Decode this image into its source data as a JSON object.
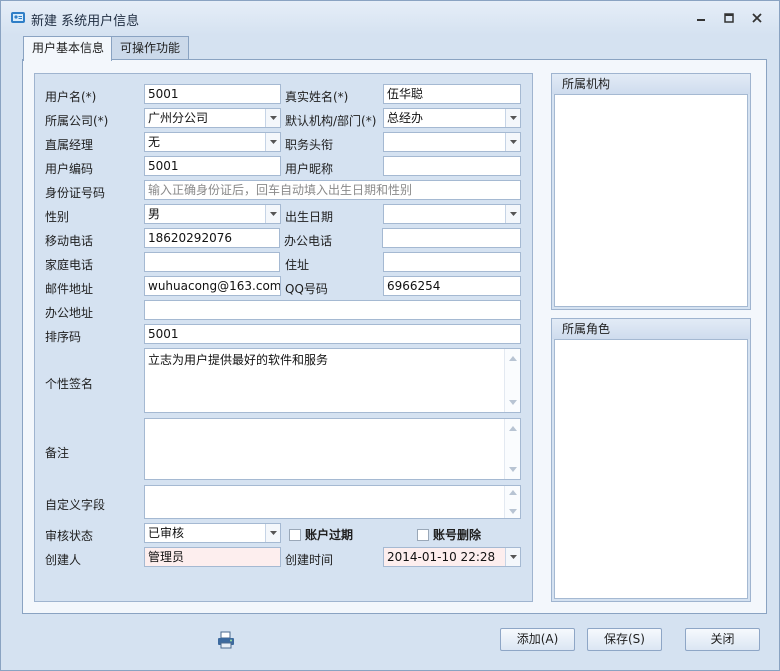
{
  "window": {
    "title": "新建 系统用户信息",
    "icon": "user-info-icon"
  },
  "tabs": [
    {
      "label": "用户基本信息",
      "active": true
    },
    {
      "label": "可操作功能",
      "active": false
    }
  ],
  "form": {
    "username": {
      "label": "用户名(*)",
      "value": "5001"
    },
    "realname": {
      "label": "真实姓名(*)",
      "value": "伍华聪"
    },
    "company": {
      "label": "所属公司(*)",
      "value": "广州分公司"
    },
    "dept": {
      "label": "默认机构/部门(*)",
      "value": "总经办"
    },
    "manager": {
      "label": "直属经理",
      "value": "无"
    },
    "jobtitle": {
      "label": "职务头衔",
      "value": ""
    },
    "usercode": {
      "label": "用户编码",
      "value": "5001"
    },
    "nickname": {
      "label": "用户昵称",
      "value": ""
    },
    "idcard": {
      "label": "身份证号码",
      "value": "",
      "placeholder": "输入正确身份证后，回车自动填入出生日期和性别"
    },
    "gender": {
      "label": "性别",
      "value": "男"
    },
    "birthday": {
      "label": "出生日期",
      "value": ""
    },
    "mobile": {
      "label": "移动电话",
      "value": "18620292076"
    },
    "officephone": {
      "label": "办公电话",
      "value": ""
    },
    "homephone": {
      "label": "家庭电话",
      "value": ""
    },
    "address": {
      "label": "住址",
      "value": ""
    },
    "email": {
      "label": "邮件地址",
      "value": "wuhuacong@163.com"
    },
    "qq": {
      "label": "QQ号码",
      "value": "6966254"
    },
    "officeaddr": {
      "label": "办公地址",
      "value": ""
    },
    "sortcode": {
      "label": "排序码",
      "value": "5001"
    },
    "signature": {
      "label": "个性签名",
      "value": "立志为用户提供最好的软件和服务"
    },
    "remark": {
      "label": "备注",
      "value": ""
    },
    "custom": {
      "label": "自定义字段",
      "value": ""
    },
    "audit": {
      "label": "审核状态",
      "value": "已审核"
    },
    "expired": {
      "label": "账户过期",
      "checked": false
    },
    "deleted": {
      "label": "账号删除",
      "checked": false
    },
    "creator": {
      "label": "创建人",
      "value": "管理员"
    },
    "createtime": {
      "label": "创建时间",
      "value": "2014-01-10 22:28"
    }
  },
  "groups": {
    "org": {
      "title": "所属机构"
    },
    "role": {
      "title": "所属角色"
    }
  },
  "buttons": {
    "add": "添加(A)",
    "save": "保存(S)",
    "close": "关闭"
  },
  "colors": {
    "window_bg": "#d5e2f1",
    "border": "#8aa3c2",
    "readonly_pink": "#fdeeee"
  }
}
